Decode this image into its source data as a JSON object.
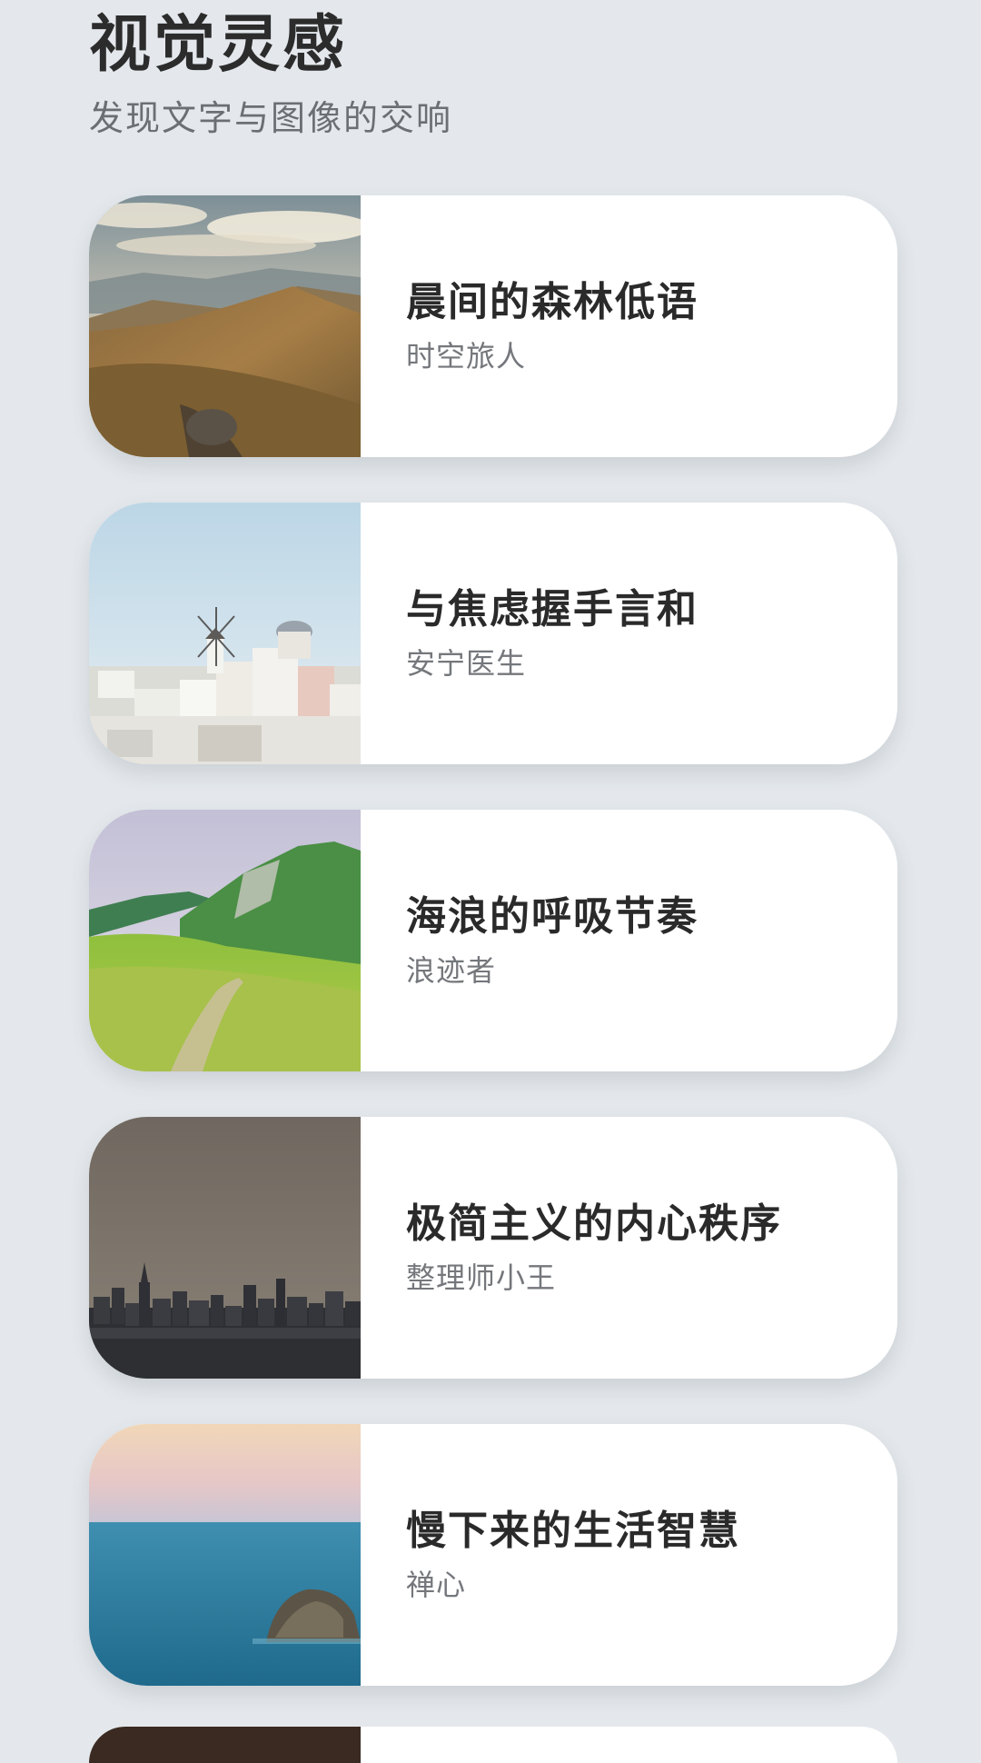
{
  "header": {
    "title": "视觉灵感",
    "subtitle": "发现文字与图像的交响"
  },
  "cards": [
    {
      "title": "晨间的森林低语",
      "author": "时空旅人",
      "image": "mountain-landscape"
    },
    {
      "title": "与焦虑握手言和",
      "author": "安宁医生",
      "image": "white-village-windmill"
    },
    {
      "title": "海浪的呼吸节奏",
      "author": "浪迹者",
      "image": "green-hills-trail"
    },
    {
      "title": "极简主义的内心秩序",
      "author": "整理师小王",
      "image": "city-skyline"
    },
    {
      "title": "慢下来的生活智慧",
      "author": "禅心",
      "image": "sea-rock"
    }
  ],
  "colors": {
    "background": "#e4e8ec",
    "card": "#ffffff",
    "title_text": "#2a2a2a",
    "author_text": "#74777b"
  }
}
